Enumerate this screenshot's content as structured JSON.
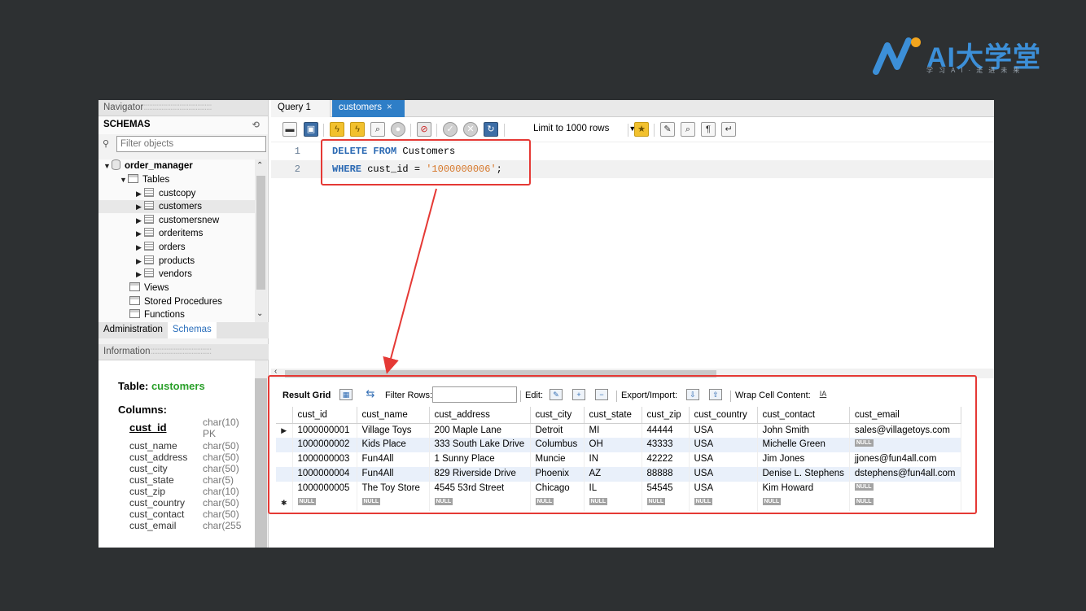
{
  "brand": {
    "name": "AI大学堂",
    "tagline": "学习AI·走进未来"
  },
  "navigator": {
    "header": "Navigator",
    "schemas_label": "SCHEMAS",
    "filter_placeholder": "Filter objects",
    "schema_name": "order_manager",
    "tables_label": "Tables",
    "tables": [
      "custcopy",
      "customers",
      "customersnew",
      "orderitems",
      "orders",
      "products",
      "vendors"
    ],
    "selected_table": "customers",
    "views_label": "Views",
    "procedures_label": "Stored Procedures",
    "functions_label": "Functions",
    "tabs": [
      "Administration",
      "Schemas"
    ],
    "active_tab": "Schemas"
  },
  "information": {
    "header": "Information",
    "table_prefix": "Table:",
    "table_name": "customers",
    "columns_label": "Columns:",
    "columns": [
      {
        "name": "cust_id",
        "type": "char(10)",
        "extra": "PK"
      },
      {
        "name": "cust_name",
        "type": "char(50)"
      },
      {
        "name": "cust_address",
        "type": "char(50)"
      },
      {
        "name": "cust_city",
        "type": "char(50)"
      },
      {
        "name": "cust_state",
        "type": "char(5)"
      },
      {
        "name": "cust_zip",
        "type": "char(10)"
      },
      {
        "name": "cust_country",
        "type": "char(50)"
      },
      {
        "name": "cust_contact",
        "type": "char(50)"
      },
      {
        "name": "cust_email",
        "type": "char(255"
      }
    ]
  },
  "tabs": [
    {
      "label": "Query 1"
    },
    {
      "label": "customers",
      "close": "×"
    }
  ],
  "toolbar": {
    "limit_label": "Limit to 1000 rows"
  },
  "editor": {
    "lines": [
      {
        "num": "1",
        "kw1": "DELETE FROM",
        "rest": " Customers"
      },
      {
        "num": "2",
        "kw1": "WHERE",
        "rest": " cust_id = ",
        "str": "'1000000006'",
        "end": ";"
      }
    ]
  },
  "result_toolbar": {
    "result_grid": "Result Grid",
    "filter_rows": "Filter Rows:",
    "edit": "Edit:",
    "export_import": "Export/Import:",
    "wrap": "Wrap Cell Content:"
  },
  "grid": {
    "columns": [
      "cust_id",
      "cust_name",
      "cust_address",
      "cust_city",
      "cust_state",
      "cust_zip",
      "cust_country",
      "cust_contact",
      "cust_email"
    ],
    "rows": [
      [
        "1000000001",
        "Village Toys",
        "200 Maple Lane",
        "Detroit",
        "MI",
        "44444",
        "USA",
        "John Smith",
        "sales@villagetoys.com"
      ],
      [
        "1000000002",
        "Kids Place",
        "333 South Lake Drive",
        "Columbus",
        "OH",
        "43333",
        "USA",
        "Michelle Green",
        null
      ],
      [
        "1000000003",
        "Fun4All",
        "1 Sunny Place",
        "Muncie",
        "IN",
        "42222",
        "USA",
        "Jim Jones",
        "jjones@fun4all.com"
      ],
      [
        "1000000004",
        "Fun4All",
        "829 Riverside Drive",
        "Phoenix",
        "AZ",
        "88888",
        "USA",
        "Denise L. Stephens",
        "dstephens@fun4all.com"
      ],
      [
        "1000000005",
        "The Toy Store",
        "4545 53rd Street",
        "Chicago",
        "IL",
        "54545",
        "USA",
        "Kim Howard",
        null
      ]
    ],
    "null_label": "NULL"
  },
  "colors": {
    "highlight": "#e53935",
    "tab_active": "#2e7ec7",
    "keyword": "#2a69b3",
    "string": "#d6772a"
  }
}
